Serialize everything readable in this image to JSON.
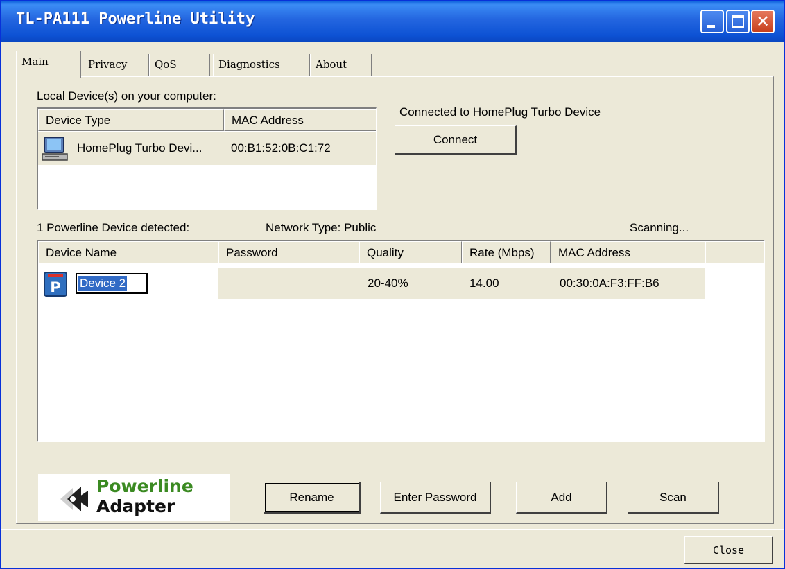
{
  "window": {
    "title": "TL-PA111 Powerline Utility",
    "close_glyph": "✕"
  },
  "tabs": [
    {
      "label": "Main",
      "active": true
    },
    {
      "label": "Privacy",
      "active": false
    },
    {
      "label": "QoS",
      "active": false
    },
    {
      "label": "Diagnostics",
      "active": false
    },
    {
      "label": "About",
      "active": false
    }
  ],
  "local": {
    "heading": "Local Device(s) on your computer:",
    "columns": [
      "Device Type",
      "MAC Address"
    ],
    "rows": [
      {
        "icon": "computer-icon",
        "device_type": "HomePlug Turbo Devi...",
        "mac": "00:B1:52:0B:C1:72"
      }
    ],
    "status_text": "Connected to HomePlug Turbo Device",
    "connect_label": "Connect"
  },
  "powerline": {
    "detected_text": "1 Powerline Device detected:",
    "network_type_text": "Network Type: Public",
    "scanning_text": "Scanning...",
    "columns": [
      "Device Name",
      "Password",
      "Quality",
      "Rate (Mbps)",
      "MAC Address"
    ],
    "rows": [
      {
        "icon": "powerline-device-icon",
        "icon_letter": "P",
        "name": "Device 2",
        "password": "",
        "quality": "20-40%",
        "rate": "14.00",
        "mac": "00:30:0A:F3:FF:B6"
      }
    ]
  },
  "logo": {
    "line1": "Powerline",
    "line2": "Adapter"
  },
  "buttons": {
    "rename": "Rename",
    "enter_password": "Enter Password",
    "add": "Add",
    "scan": "Scan",
    "close": "Close"
  },
  "colors": {
    "titlebar": "#0A5FD9",
    "selection": "#316AC5",
    "face": "#ECE9D8",
    "logo_green": "#3B8A22"
  }
}
